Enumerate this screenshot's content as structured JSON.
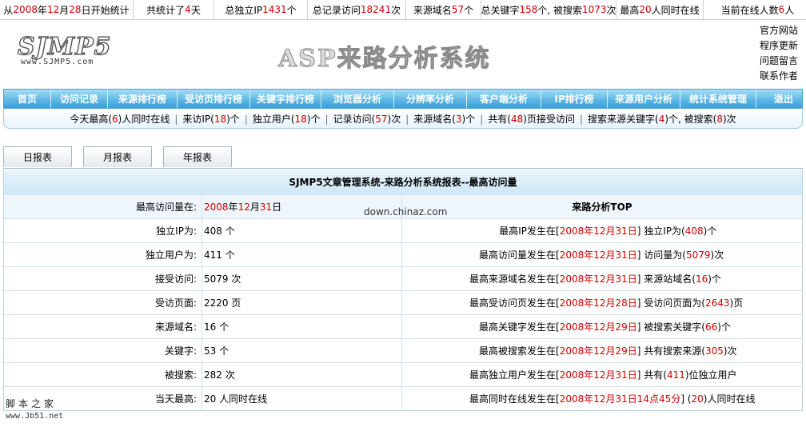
{
  "topbar": [
    {
      "parts": [
        "从",
        "2008",
        "年",
        "12",
        "月",
        "28",
        "日开始统计"
      ],
      "red": [
        1,
        3,
        5
      ],
      "width": 166
    },
    {
      "parts": [
        "共统计了",
        "4",
        "天"
      ],
      "red": [
        1
      ],
      "width": 100
    },
    {
      "parts": [
        "总独立IP",
        "1431",
        "个"
      ],
      "red": [
        1
      ],
      "width": 116
    },
    {
      "parts": [
        "总记录访问",
        "18241",
        "次"
      ],
      "red": [
        1
      ],
      "width": 122
    },
    {
      "parts": [
        "来源域名",
        "57",
        "个"
      ],
      "red": [
        1
      ],
      "width": 93
    },
    {
      "parts": [
        "总关键字",
        "158",
        "个, 被搜索",
        "1073",
        "次"
      ],
      "red": [
        1,
        3
      ],
      "width": 168
    },
    {
      "parts": [
        "最高",
        "20",
        "人同时在线"
      ],
      "red": [
        1
      ],
      "width": 108
    },
    {
      "parts": [
        "当前在线人数 ",
        "6",
        "人"
      ],
      "red": [
        1
      ],
      "width": 135
    }
  ],
  "header": {
    "logo_text": "SJMP5",
    "logo_url": "www.SJMP5.com",
    "title": "ASP来路分析系统",
    "links": [
      "官方网站",
      "程序更新",
      "问题留言",
      "联系作者"
    ]
  },
  "nav": [
    {
      "label": "首页",
      "width": 58
    },
    {
      "label": "访问记录",
      "width": 70
    },
    {
      "label": "来源排行榜",
      "width": 86
    },
    {
      "label": "受访页排行榜",
      "width": 90
    },
    {
      "label": "关键字排行榜",
      "width": 88
    },
    {
      "label": "浏览器分析",
      "width": 90
    },
    {
      "label": "分辨率分析",
      "width": 90
    },
    {
      "label": "客户端分析",
      "width": 92
    },
    {
      "label": "IP排行榜",
      "width": 82
    },
    {
      "label": "来源用户分析",
      "width": 90
    },
    {
      "label": "统计系统管理",
      "width": 94
    },
    {
      "label": "退出",
      "width": 68
    }
  ],
  "quickbar": [
    {
      "parts": [
        "今天最高(",
        "6",
        ")人同时在线"
      ],
      "red": [
        1
      ]
    },
    {
      "parts": [
        "来访IP(",
        "18",
        ")个"
      ],
      "red": [
        1
      ]
    },
    {
      "parts": [
        "独立用户(",
        "18",
        ")个"
      ],
      "red": [
        1
      ]
    },
    {
      "parts": [
        "记录访问(",
        "57",
        ")次"
      ],
      "red": [
        1
      ]
    },
    {
      "parts": [
        "来源域名(",
        "3",
        ")个"
      ],
      "red": [
        1
      ]
    },
    {
      "parts": [
        "共有(",
        "48",
        ")页接受访问"
      ],
      "red": [
        1
      ]
    },
    {
      "parts": [
        "搜索来源关键字(",
        "4",
        ")个, 被搜索(",
        "8",
        ")次"
      ],
      "red": [
        1,
        3
      ]
    }
  ],
  "tabs": [
    "日报表",
    "月报表",
    "年报表"
  ],
  "report": {
    "title": "SJMP5文章管理系统-来路分析系统报表--最高访问量",
    "peak_label": "最高访问量在:",
    "peak_parts": [
      "2008",
      "年",
      "12",
      "月",
      "31",
      "日"
    ],
    "peak_red": [
      0,
      2,
      4
    ],
    "top_header": "来路分析TOP",
    "rows": [
      {
        "label": "独立IP为:",
        "value": "408 个",
        "r_label": "最高IP发生在",
        "r_parts": [
          "[",
          "2008年12月31日",
          "] 独立IP为(",
          "408",
          ")个"
        ],
        "r_red": [
          1,
          3
        ]
      },
      {
        "label": "独立用户为:",
        "value": "411 个",
        "r_label": "最高访问量发生在",
        "r_parts": [
          "[",
          "2008年12月31日",
          "] 访问量为(",
          "5079",
          ")次"
        ],
        "r_red": [
          1,
          3
        ]
      },
      {
        "label": "接受访问:",
        "value": "5079 次",
        "r_label": "最高来源域名发生在",
        "r_parts": [
          "[",
          "2008年12月31日",
          "] 来源站域名(",
          "16",
          ")个"
        ],
        "r_red": [
          1,
          3
        ]
      },
      {
        "label": "受访页面:",
        "value": "2220 页",
        "r_label": "最高受访问页发生在",
        "r_parts": [
          "[",
          "2008年12月28日",
          "] 受访问页面为(",
          "2643",
          ")页"
        ],
        "r_red": [
          1,
          3
        ]
      },
      {
        "label": "来源域名:",
        "value": "16 个",
        "r_label": "最高关键字发生在",
        "r_parts": [
          "[",
          "2008年12月29日",
          "] 被搜索关键字(",
          "66",
          ")个"
        ],
        "r_red": [
          1,
          3
        ]
      },
      {
        "label": "关键字:",
        "value": "53 个",
        "r_label": "最高被搜索发生在",
        "r_parts": [
          "[",
          "2008年12月29日",
          "] 共有搜索来源(",
          "305",
          ")次"
        ],
        "r_red": [
          1,
          3
        ]
      },
      {
        "label": "被搜索:",
        "value": "282 次",
        "r_label": "最高独立用户发生在",
        "r_parts": [
          "[",
          "2008年12月31日",
          "] 共有(",
          "411",
          ")位独立用户"
        ],
        "r_red": [
          1,
          3
        ]
      },
      {
        "label": "当天最高:",
        "value": "20 人同时在线",
        "r_label": "最高同时在线发生在",
        "r_parts": [
          "[",
          "2008年12月31日14点45分",
          "] (",
          "20",
          ")人同时在线"
        ],
        "r_red": [
          1,
          3
        ]
      }
    ]
  },
  "watermarks": {
    "chinaz": "down.chinaz.com",
    "jb51_a": "脚本之家",
    "jb51_b": "www.Jb51.net"
  },
  "colors": {
    "accent_red": "#cc0000",
    "nav_blue": "#5fb8e6"
  }
}
